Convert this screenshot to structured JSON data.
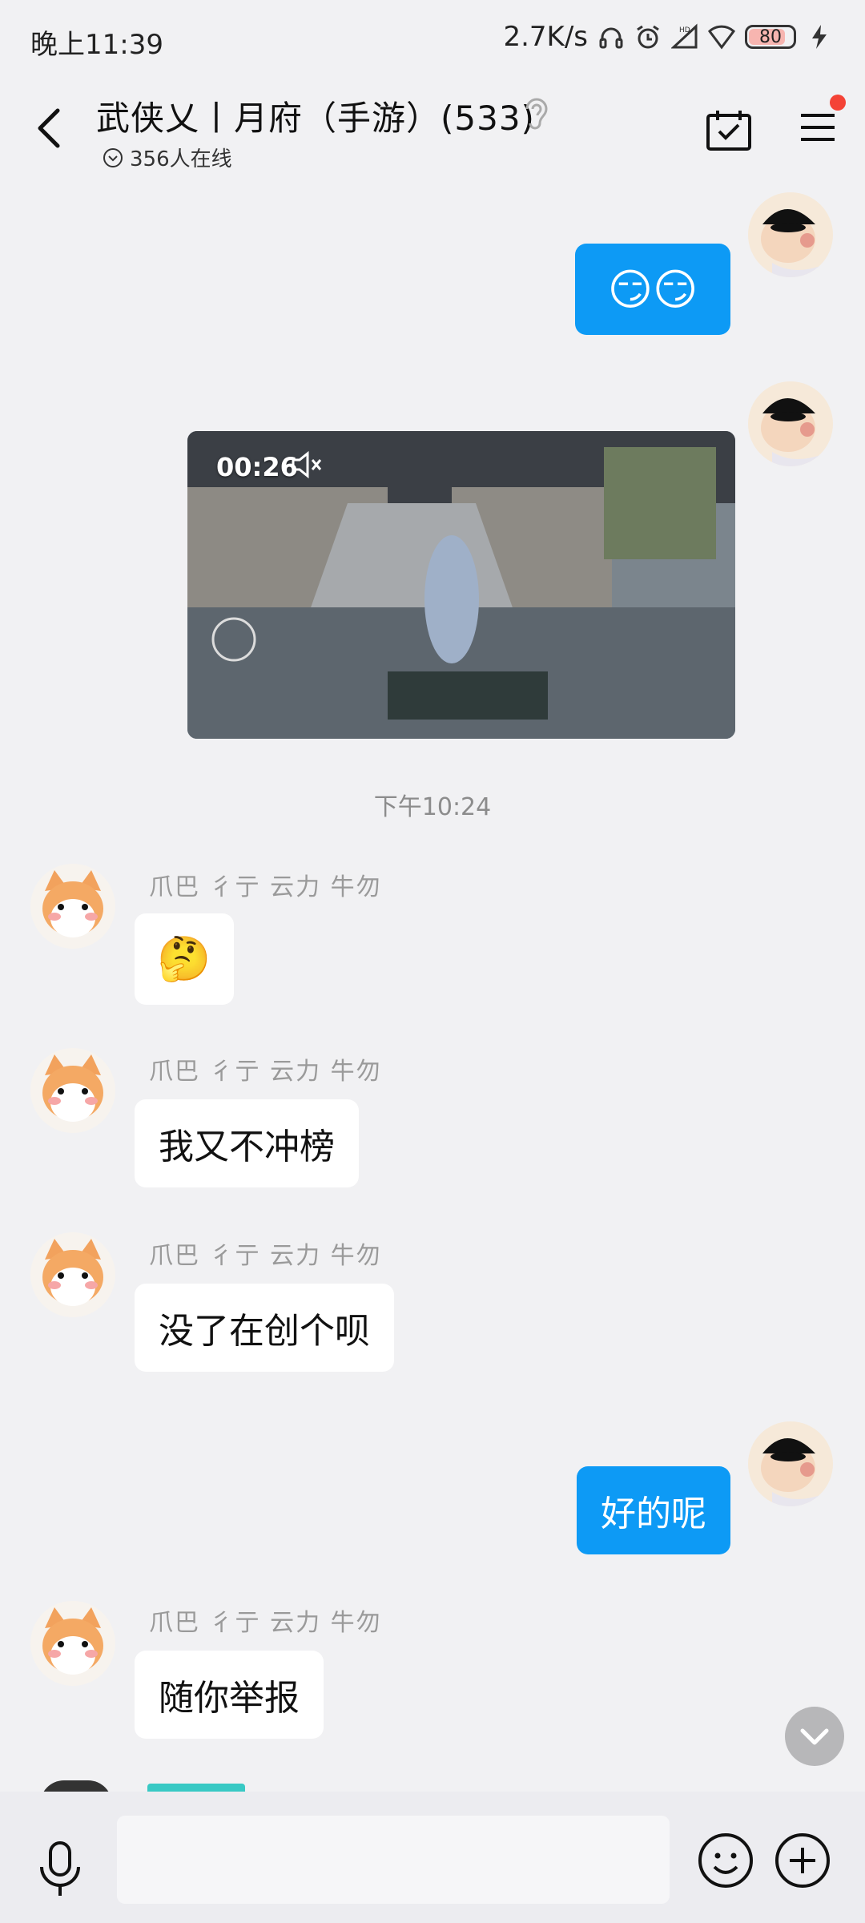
{
  "status_bar": {
    "time": "晚上11:39",
    "network_speed": "2.7K/s",
    "battery": "80",
    "hd": "HD",
    "icons": [
      "headphone-icon",
      "alarm-icon",
      "signal-icon",
      "wifi-icon",
      "battery-icon",
      "charging-icon"
    ]
  },
  "header": {
    "title": "武侠乂丨月府（手游）(533)",
    "online": "356人在线",
    "icons": [
      "back-arrow-icon",
      "ear-icon",
      "calendar-check-icon",
      "menu-icon"
    ]
  },
  "messages": {
    "msg1": {
      "type": "emoji",
      "sender": "self",
      "content": "😏😏"
    },
    "msg2": {
      "type": "video",
      "sender": "self",
      "duration": "00:26"
    },
    "timestamp": "下午10:24",
    "msg3": {
      "type": "emoji",
      "sender": "爪巴 彳亍 云力 牛勿",
      "content": "🤔"
    },
    "msg4": {
      "type": "text",
      "sender": "爪巴 彳亍 云力 牛勿",
      "content": "我又不冲榜"
    },
    "msg5": {
      "type": "text",
      "sender": "爪巴 彳亍 云力 牛勿",
      "content": "没了在创个呗"
    },
    "msg6": {
      "type": "text",
      "sender": "self",
      "content": "好的呢"
    },
    "msg7": {
      "type": "text",
      "sender": "爪巴 彳亍 云力 牛勿",
      "content": "随你举报"
    }
  },
  "input_bar": {
    "value": "",
    "icons": [
      "microphone-icon",
      "smiley-icon",
      "plus-icon"
    ]
  },
  "colors": {
    "self_bubble": "#0d9af5",
    "other_bubble": "#ffffff",
    "background": "#f1f1f3",
    "badge": "#f44336"
  }
}
